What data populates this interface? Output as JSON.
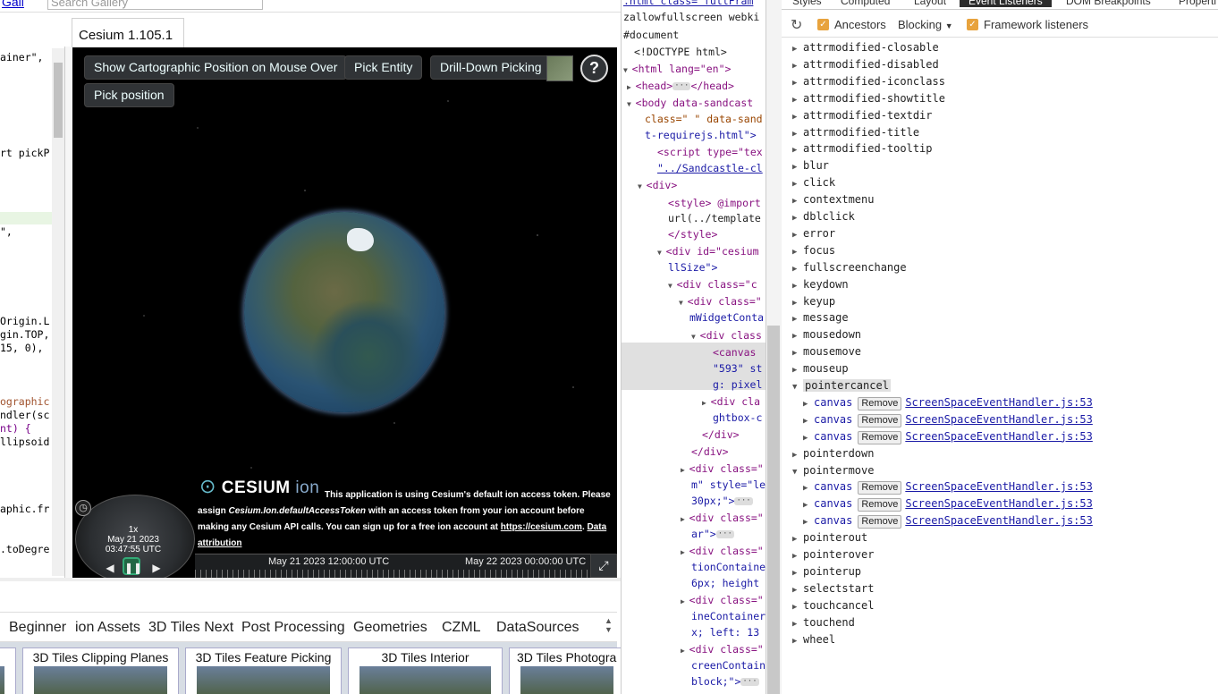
{
  "sandcastle": {
    "gallery_link": "Gall",
    "search_placeholder": "Search Gallery",
    "tab_label": "Cesium 1.105.1",
    "code_lines": [
      "ainer\",",
      "rt pickP",
      "\",",
      "Origin.L",
      "gin.TOP,",
      "15, 0),",
      "ographic",
      "ndler(sc",
      "nt) {",
      "llipsoid",
      "aphic.fr",
      ".toDegre"
    ],
    "viewer": {
      "buttons": [
        "Show Cartographic Position on Mouse Over",
        "Pick Entity",
        "Drill-Down Picking",
        "Pick position"
      ],
      "help": "?",
      "credit_logo": "CESIUM",
      "credit_logo_suffix": "ion",
      "credit_text": "This application is using Cesium's default ion access token. Please assign",
      "credit_token": "Cesium.Ion.defaultAccessToken",
      "credit_text2": "with an access token from your ion account before making any Cesium API calls. You can sign up for a free ion account at",
      "credit_url": "https://cesium.com",
      "credit_end": ".",
      "data_attr": "Data attribution",
      "anim_speed": "1x",
      "anim_date": "May 21 2023",
      "anim_time": "03:47:55 UTC",
      "timeline_start": "May 21 2023 12:00:00 UTC",
      "timeline_end": "May 22 2023 00:00:00 UTC"
    },
    "nav_tabs": [
      "Beginner",
      "ion Assets",
      "3D Tiles Next",
      "Post Processing",
      "Geometries",
      "CZML",
      "DataSources"
    ],
    "gallery_cards": [
      "3D Tiles Clipping Planes",
      "3D Tiles Feature Picking",
      "3D Tiles Interior",
      "3D Tiles Photogra"
    ]
  },
  "dom_panel": {
    "lines": [
      {
        "t": ".html  class= fullFram",
        "k": "lnk"
      },
      {
        "t": "zallowfullscreen webki",
        "k": "txt"
      },
      {
        "t": "#document",
        "k": "txt"
      },
      {
        "t": "<!DOCTYPE html>",
        "k": "txt"
      },
      {
        "t": "<html lang=\"en\">",
        "k": "tag"
      },
      {
        "t": "<head>",
        "k": "tag"
      },
      {
        "t": "<body data-sandcast",
        "k": "tag"
      },
      {
        "t": "class=\" \" data-sand",
        "k": "attr"
      },
      {
        "t": "t-requirejs.html\">",
        "k": "val"
      },
      {
        "t": "<script type=\"tex",
        "k": "tag"
      },
      {
        "t": "\"../Sandcastle-cl",
        "k": "lnk"
      },
      {
        "t": "<div>",
        "k": "tag"
      },
      {
        "t": "<style> @import",
        "k": "tag"
      },
      {
        "t": "url(../template",
        "k": "txt"
      },
      {
        "t": "</style>",
        "k": "tag"
      },
      {
        "t": "<div id=\"cesium",
        "k": "tag"
      },
      {
        "t": "llSize\">",
        "k": "val"
      },
      {
        "t": "<div class=\"c",
        "k": "tag"
      },
      {
        "t": "<div class=\"",
        "k": "tag"
      },
      {
        "t": "mWidgetConta",
        "k": "val"
      },
      {
        "t": "<div class",
        "k": "tag"
      },
      {
        "t": "<canvas",
        "k": "tag"
      },
      {
        "t": "\"593\" st",
        "k": "val"
      },
      {
        "t": "g: pixel",
        "k": "val"
      },
      {
        "t": "<div cla",
        "k": "tag"
      },
      {
        "t": "ghtbox-c",
        "k": "val"
      },
      {
        "t": "</div>",
        "k": "tag"
      },
      {
        "t": "</div>",
        "k": "tag"
      },
      {
        "t": "<div class=\"",
        "k": "tag"
      },
      {
        "t": "m\" style=\"le",
        "k": "val"
      },
      {
        "t": "30px;\">",
        "k": "val"
      },
      {
        "t": "<div class=\"",
        "k": "tag"
      },
      {
        "t": "ar\">",
        "k": "val"
      },
      {
        "t": "<div class=\"",
        "k": "tag"
      },
      {
        "t": "tionContaine",
        "k": "val"
      },
      {
        "t": "6px; height",
        "k": "val"
      },
      {
        "t": "<div class=\"",
        "k": "tag"
      },
      {
        "t": "ineContainer",
        "k": "val"
      },
      {
        "t": "x; left: 13",
        "k": "val"
      },
      {
        "t": "<div class=\"",
        "k": "tag"
      },
      {
        "t": "creenContain",
        "k": "val"
      },
      {
        "t": "block;\">",
        "k": "val"
      }
    ]
  },
  "event_panel": {
    "tabs": [
      "Styles",
      "Computed",
      "Layout",
      "Event Listeners",
      "DOM Breakpoints",
      "Properti"
    ],
    "active_tab": "Event Listeners",
    "ancestors_label": "Ancestors",
    "blocking_label": "Blocking",
    "framework_label": "Framework listeners",
    "events": [
      "attrmodified-closable",
      "attrmodified-disabled",
      "attrmodified-iconclass",
      "attrmodified-showtitle",
      "attrmodified-textdir",
      "attrmodified-title",
      "attrmodified-tooltip",
      "blur",
      "click",
      "contextmenu",
      "dblclick",
      "error",
      "focus",
      "fullscreenchange",
      "keydown",
      "keyup",
      "message",
      "mousedown",
      "mousemove",
      "mouseup",
      "pointercancel",
      "pointerdown",
      "pointermove",
      "pointerout",
      "pointerover",
      "pointerup",
      "selectstart",
      "touchcancel",
      "touchend",
      "wheel"
    ],
    "expanded": {
      "pointercancel": [
        {
          "node": "canvas",
          "remove": "Remove",
          "src": "ScreenSpaceEventHandler.js:53"
        },
        {
          "node": "canvas",
          "remove": "Remove",
          "src": "ScreenSpaceEventHandler.js:53"
        },
        {
          "node": "canvas",
          "remove": "Remove",
          "src": "ScreenSpaceEventHandler.js:53"
        }
      ],
      "pointermove": [
        {
          "node": "canvas",
          "remove": "Remove",
          "src": "ScreenSpaceEventHandler.js:53"
        },
        {
          "node": "canvas",
          "remove": "Remove",
          "src": "ScreenSpaceEventHandler.js:53"
        },
        {
          "node": "canvas",
          "remove": "Remove",
          "src": "ScreenSpaceEventHandler.js:53"
        }
      ]
    },
    "selected_event": "pointercancel"
  }
}
